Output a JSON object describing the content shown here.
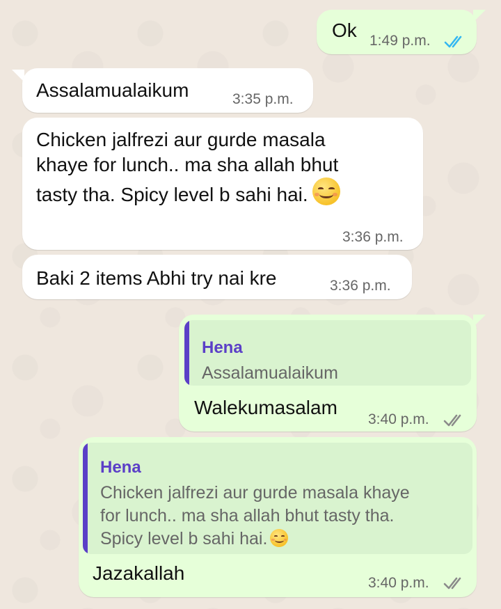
{
  "messages": [
    {
      "id": "m1",
      "direction": "outgoing",
      "text": "Ok",
      "time": "1:49 p.m.",
      "status": "read",
      "tick_color": "#34b7f1"
    },
    {
      "id": "m2",
      "direction": "incoming",
      "text": "Assalamualaikum",
      "time": "3:35 p.m."
    },
    {
      "id": "m3",
      "direction": "incoming",
      "text_lines": [
        "Chicken jalfrezi aur gurde masala",
        "khaye for lunch.. ma sha allah bhut",
        "tasty tha. Spicy level b sahi hai."
      ],
      "emoji": "smiling-face-icon",
      "time": "3:36 p.m."
    },
    {
      "id": "m4",
      "direction": "incoming",
      "text": "Baki 2 items Abhi try nai kre",
      "time": "3:36 p.m."
    },
    {
      "id": "m5",
      "direction": "outgoing",
      "quote": {
        "author": "Hena",
        "text": "Assalamualaikum"
      },
      "text": "Walekumasalam",
      "time": "3:40 p.m.",
      "status": "delivered",
      "tick_color": "#8a8a8a"
    },
    {
      "id": "m6",
      "direction": "outgoing",
      "quote": {
        "author": "Hena",
        "text_lines": [
          "Chicken jalfrezi aur gurde masala khaye",
          "for lunch.. ma sha allah bhut tasty tha.",
          "Spicy level b sahi hai."
        ],
        "emoji": "smiling-face-icon"
      },
      "text": "Jazakallah",
      "time": "3:40 p.m.",
      "status": "delivered",
      "tick_color": "#8a8a8a"
    }
  ],
  "colors": {
    "outgoing_bubble": "#e6ffd9",
    "incoming_bubble": "#ffffff",
    "quote_accent": "#5b3fc7",
    "wallpaper": "#efe7de"
  }
}
